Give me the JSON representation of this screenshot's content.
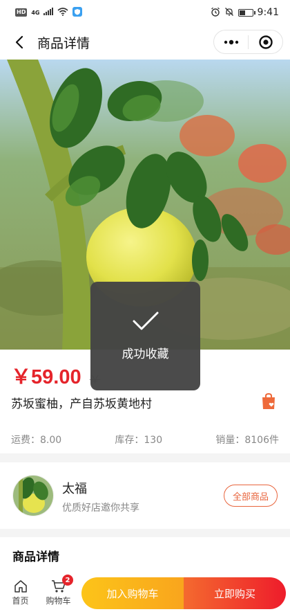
{
  "status_bar": {
    "hd": "HD",
    "network": "4G",
    "time": "9:41",
    "battery_level": 0.45,
    "icons": [
      "hd-icon",
      "signal-icon",
      "wifi-icon",
      "shield-app-icon",
      "alarm-icon",
      "mute-icon",
      "battery-icon"
    ]
  },
  "nav": {
    "title": "商品详情",
    "back_icon": "chevron-left-icon",
    "menu_icon": "more-dots-icon",
    "close_icon": "target-circle-icon"
  },
  "product": {
    "image_alt": "pomelo-on-tree-photo",
    "price": "￥59.00",
    "old_price": "￥",
    "title": "苏坂蜜柚，产自苏坂黄地村",
    "favorite_icon": "shopping-bag-heart-icon",
    "shipping": "运费：8.00",
    "stock": "库存：130",
    "sales": "销量：8106件"
  },
  "shop": {
    "name": "太福",
    "slogan": "优质好店邀你共享",
    "all_products_label": "全部商品"
  },
  "details": {
    "title": "商品详情"
  },
  "bottom_bar": {
    "home_label": "首页",
    "cart_label": "购物车",
    "cart_count": "2",
    "add_to_cart_label": "加入购物车",
    "buy_now_label": "立即购买"
  },
  "toast": {
    "text": "成功收藏",
    "icon": "checkmark-icon"
  },
  "colors": {
    "price_red": "#e5242b",
    "accent_orange": "#e8643c",
    "add_cart_gradient": [
      "#fcc419",
      "#f9a51d"
    ],
    "buy_gradient": [
      "#f46a2f",
      "#ee1c2b"
    ]
  }
}
